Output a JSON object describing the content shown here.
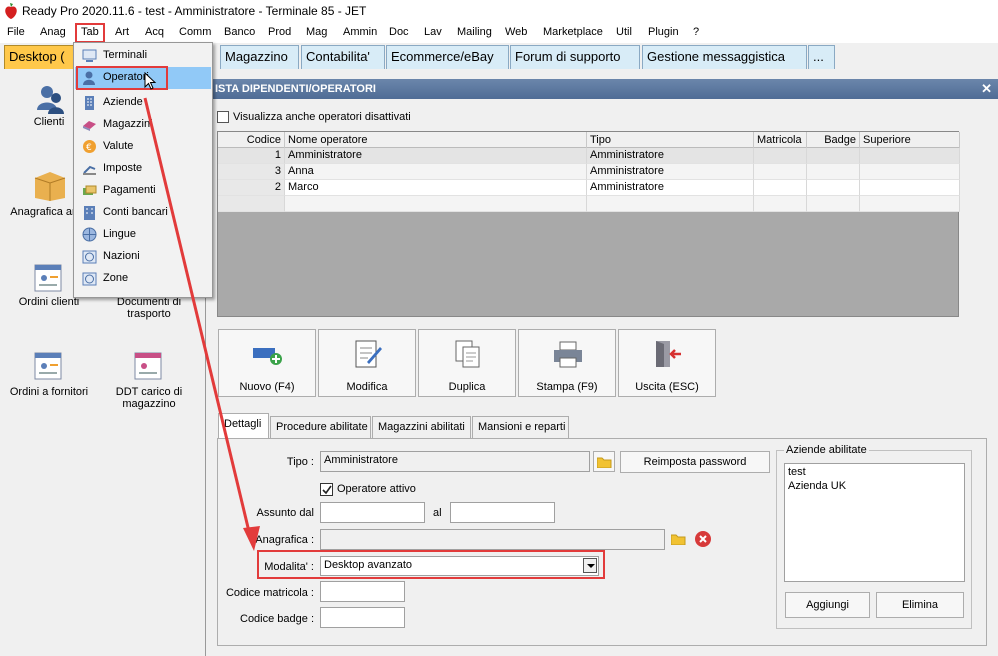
{
  "window": {
    "title": "Ready Pro 2020.11.6 - test - Amministratore - Terminale 85 - JET"
  },
  "menubar": [
    "File",
    "Anag",
    "Tab",
    "Art",
    "Acq",
    "Comm",
    "Banco",
    "Prod",
    "Mag",
    "Ammin",
    "Doc",
    "Lav",
    "Mailing",
    "Web",
    "Marketplace",
    "Util",
    "Plugin",
    "?"
  ],
  "desktop_tabs": [
    "Desktop (",
    "Magazzino",
    "Contabilita'",
    "Ecommerce/eBay",
    "Forum di supporto",
    "Gestione messaggistica",
    "..."
  ],
  "tab_menu": {
    "items": [
      "Terminali",
      "Operatori",
      "Aziende",
      "Magazzini",
      "Valute",
      "Imposte",
      "Pagamenti",
      "Conti bancari",
      "Lingue",
      "Nazioni",
      "Zone"
    ],
    "highlighted": "Operatori"
  },
  "desktop_icons": [
    "Clienti",
    "Anagrafica ar",
    "Ordini clienti",
    "Documenti di trasporto",
    "Ordini a fornitori",
    "DDT carico di magazzino"
  ],
  "dialog": {
    "title": "ISTA DIPENDENTI/OPERATORI",
    "show_disabled_label": "Visualizza anche operatori disattivati",
    "grid": {
      "headers": [
        "Codice",
        "Nome operatore",
        "Tipo",
        "Matricola",
        "Badge",
        "Superiore"
      ],
      "rows": [
        {
          "codice": "1",
          "nome": "Amministratore",
          "tipo": "Amministratore"
        },
        {
          "codice": "3",
          "nome": "Anna",
          "tipo": "Amministratore"
        },
        {
          "codice": "2",
          "nome": "Marco",
          "tipo": "Amministratore"
        }
      ]
    },
    "toolbar": {
      "new": "Nuovo (F4)",
      "edit": "Modifica",
      "duplicate": "Duplica",
      "print": "Stampa (F9)",
      "exit": "Uscita (ESC)"
    },
    "subtabs": [
      "Dettagli",
      "Procedure abilitate",
      "Magazzini abilitati",
      "Mansioni e reparti"
    ],
    "form": {
      "tipo_label": "Tipo :",
      "tipo_value": "Amministratore",
      "reset_password": "Reimposta password",
      "active_label": "Operatore attivo",
      "hired_from_label": "Assunto dal",
      "to_label": "al",
      "anagrafica_label": "Anagrafica :",
      "modalita_label": "Modalita' :",
      "modalita_value": "Desktop avanzato",
      "matricola_label": "Codice matricola :",
      "badge_label": "Codice badge :"
    },
    "companies": {
      "label": "Aziende abilitate",
      "items": [
        "test",
        "Azienda UK"
      ],
      "add": "Aggiungi",
      "remove": "Elimina"
    }
  },
  "colors": {
    "highlight_box": "#e23b3b",
    "active_tab": "#ffc84a",
    "menu_highlight": "#91c9f7"
  }
}
